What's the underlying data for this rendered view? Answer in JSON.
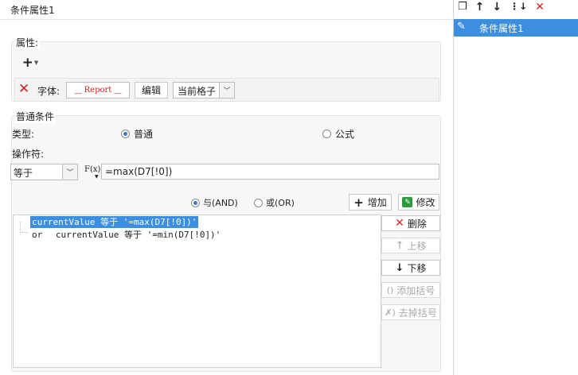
{
  "title": "条件属性1",
  "properties": {
    "label": "属性:",
    "add_icon": "plus-icon",
    "font_label": "字体:",
    "font_preview": "Report",
    "edit_button": "编辑",
    "scope_select": "当前格子"
  },
  "conditions": {
    "group_label": "普通条件",
    "type_label": "类型:",
    "type_options": [
      "普通",
      "公式"
    ],
    "type_selected": "普通",
    "operator_label": "操作符:",
    "operator_value": "等于",
    "fx_label": "F(x)",
    "formula_value": "=max(D7[!0])",
    "logic_options": [
      "与(AND)",
      "或(OR)"
    ],
    "logic_selected": "与(AND)",
    "add_button": "增加",
    "modify_button": "修改",
    "rows": [
      {
        "prefix": "",
        "text": "currentValue 等于 '=max(D7[!0])'",
        "selected": true
      },
      {
        "prefix": "or",
        "text": "currentValue 等于 '=min(D7[!0])'",
        "selected": false
      }
    ],
    "side_buttons": {
      "delete": "删除",
      "move_up": "上移",
      "move_down": "下移",
      "add_bracket": "添加括号",
      "remove_bracket": "去掉括号"
    }
  },
  "sidebar": {
    "items": [
      {
        "label": "条件属性1",
        "icon": "pencil-icon",
        "selected": true
      }
    ],
    "toolbar_icons": [
      "copy-icon",
      "arrow-up-icon",
      "arrow-down-icon",
      "sort-down-icon",
      "close-icon"
    ]
  },
  "colors": {
    "selection": "#3b8ee0",
    "delete_red": "#d42121",
    "add_green": "#2a9a3a"
  }
}
